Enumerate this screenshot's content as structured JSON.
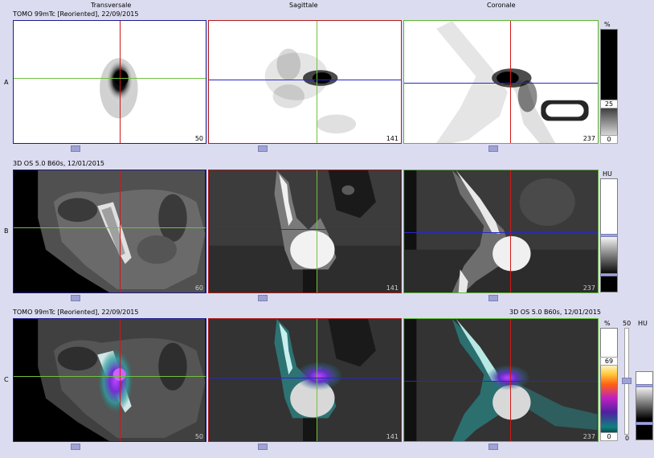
{
  "views": {
    "transversale": "Transversale",
    "sagittale": "Sagittale",
    "coronale": "Coronale"
  },
  "rows": {
    "a": {
      "letter": "A",
      "series": "TOMO 99mTc [Reoriented], 22/09/2015",
      "unit": "%",
      "scale_value": "25",
      "scale_min": "0",
      "slices": [
        "50",
        "141",
        "237"
      ]
    },
    "b": {
      "letter": "B",
      "series": "3D OS 5.0 B60s, 12/01/2015",
      "unit": "HU",
      "slices": [
        "60",
        "141",
        "237"
      ]
    },
    "c": {
      "letter": "C",
      "series_left": "TOMO 99mTc [Reoriented], 22/09/2015",
      "series_right": "3D OS 5.0 B60s, 12/01/2015",
      "unit_left": "%",
      "unit_right": "HU",
      "scale_value": "69",
      "scale_min": "0",
      "fusion_value": "50",
      "fusion_min": "0",
      "slices": [
        "50",
        "141",
        "237"
      ]
    }
  },
  "colors": {
    "transversal_border": "#1d1d8c",
    "sagittal_border": "#b01c1c",
    "coronal_border": "#5cb830",
    "crosshair_red": "#d01818",
    "crosshair_green": "#70c040",
    "crosshair_blue": "#2828c8",
    "background": "#dcdcf0"
  }
}
